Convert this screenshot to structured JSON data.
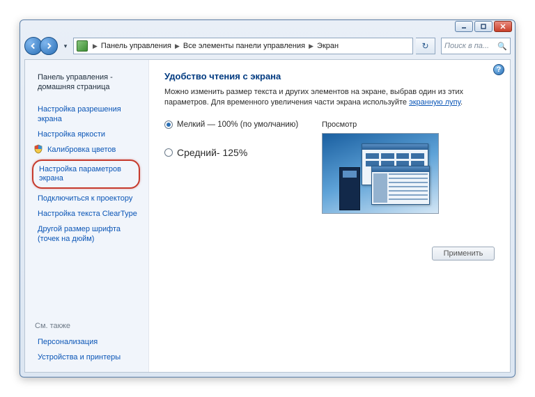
{
  "breadcrumb": {
    "item1": "Панель управления",
    "item2": "Все элементы панели управления",
    "item3": "Экран"
  },
  "search": {
    "placeholder": "Поиск в па..."
  },
  "sidebar": {
    "home": "Панель управления - домашняя страница",
    "resolution": "Настройка разрешения экрана",
    "brightness": "Настройка яркости",
    "calibration": "Калибровка цветов",
    "highlighted": "Настройка параметров экрана",
    "projector": "Подключиться к проектору",
    "cleartype": "Настройка текста ClearType",
    "dpi": "Другой размер шрифта (точек на дюйм)",
    "see_also": "См. также",
    "personalization": "Персонализация",
    "devices": "Устройства и принтеры"
  },
  "main": {
    "title": "Удобство чтения с экрана",
    "desc_before": "Можно изменить размер текста и других элементов на экране, выбрав один из этих параметров. Для временного увеличения части экрана используйте ",
    "desc_link": "экранную лупу",
    "desc_after": ".",
    "option_small": "Мелкий — 100% (по умолчанию)",
    "option_medium": "Средний- 125%",
    "preview_label": "Просмотр",
    "apply": "Применить"
  }
}
